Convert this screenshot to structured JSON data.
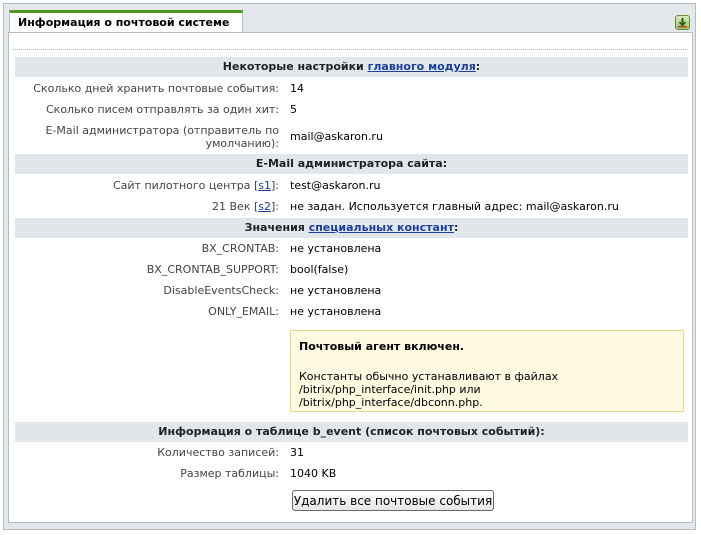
{
  "tab": {
    "title": "Информация о почтовой системе",
    "icon": "export-icon"
  },
  "sections": {
    "main_settings": {
      "prefix": "Некоторые настройки ",
      "link": "главного модуля",
      "suffix": ":"
    },
    "admin_email": {
      "title": "E-Mail администратора сайта:"
    },
    "constants": {
      "prefix": "Значения ",
      "link": "специальных констант",
      "suffix": ":"
    },
    "table_info": {
      "title": "Информация о таблице b_event (список почтовых событий):"
    }
  },
  "settings": [
    {
      "label": "Сколько дней хранить почтовые события:",
      "value": "14"
    },
    {
      "label": "Сколько писем отправлять за один хит:",
      "value": "5"
    },
    {
      "label_line1": "E-Mail администратора (отправитель по",
      "label_line2": "умолчанию):",
      "value": "mail@askaron.ru"
    }
  ],
  "sites": [
    {
      "label_prefix": "Сайт пилотного центра [",
      "site_id": "s1",
      "label_suffix": "]:",
      "value": "test@askaron.ru"
    },
    {
      "label_prefix": "21 Век [",
      "site_id": "s2",
      "label_suffix": "]:",
      "value": "не задан. Используется главный адрес: mail@askaron.ru"
    }
  ],
  "constants": [
    {
      "label": "BX_CRONTAB:",
      "value": "не установлена"
    },
    {
      "label": "BX_CRONTAB_SUPPORT:",
      "value": "bool(false)"
    },
    {
      "label": "DisableEventsCheck:",
      "value": "не установлена"
    },
    {
      "label": "ONLY_EMAIL:",
      "value": "не установлена"
    }
  ],
  "notice": {
    "title": "Почтовый агент включен.",
    "line1": "Константы обычно устанавливают в файлах",
    "line2": "/bitrix/php_interface/init.php или",
    "line3": "/bitrix/php_interface/dbconn.php."
  },
  "table_stats": [
    {
      "label": "Количество записей:",
      "value": "31"
    },
    {
      "label": "Размер таблицы:",
      "value": "1040 KB"
    }
  ],
  "actions": {
    "delete_all_label": "Удалить все почтовые события"
  }
}
